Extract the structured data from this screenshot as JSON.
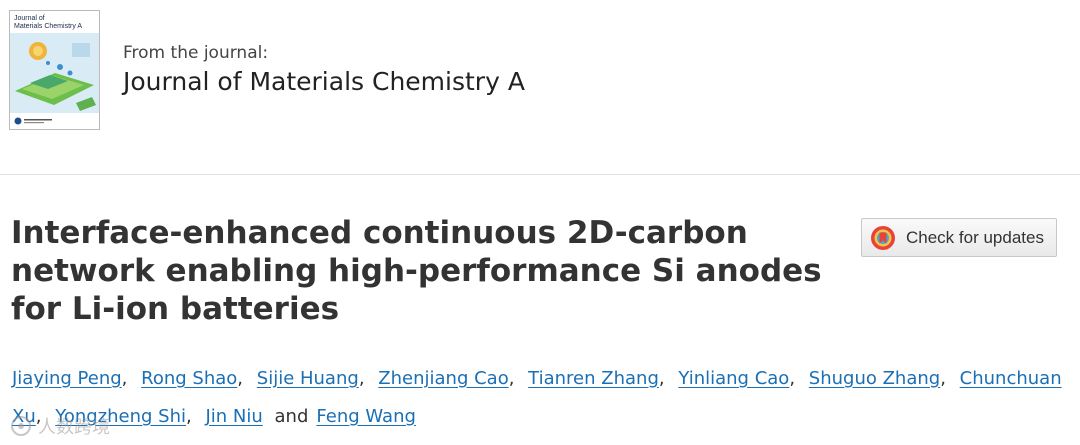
{
  "journal": {
    "from_label": "From the journal:",
    "name": "Journal of Materials Chemistry A",
    "cover_title_line1": "Journal of",
    "cover_title_line2": "Materials Chemistry A"
  },
  "article": {
    "title": "Interface-enhanced continuous 2D-carbon network enabling high-performance Si anodes for Li-ion batteries",
    "check_updates_label": "Check for updates"
  },
  "authors": {
    "names": [
      "Jiaying Peng",
      "Rong Shao",
      "Sijie Huang",
      "Zhenjiang Cao",
      "Tianren Zhang",
      "Yinliang Cao",
      "Shuguo Zhang",
      "Chunchuan Xu",
      "Yongzheng Shi",
      "Jin Niu",
      "Feng Wang"
    ],
    "separator": ",",
    "conjunction": "and"
  },
  "watermark": {
    "text": "人数跨境"
  },
  "colors": {
    "link": "#1a6fb5",
    "title": "#333333",
    "badge_ring": "#e8433b"
  },
  "icons": {
    "journal_cover": "journal-cover-thumbnail",
    "check_updates": "crossmark-icon",
    "watermark": "watermark-logo-icon"
  }
}
